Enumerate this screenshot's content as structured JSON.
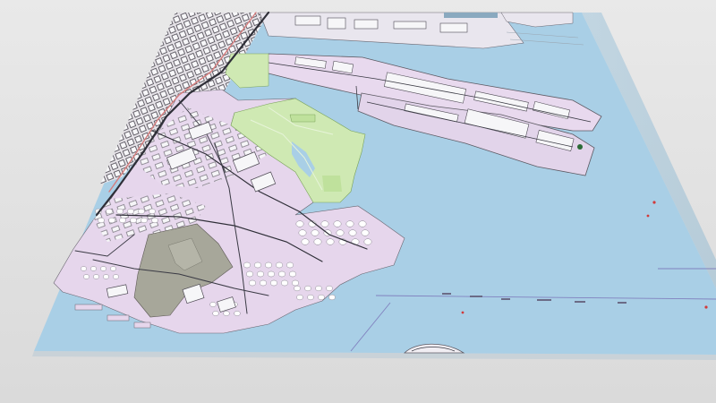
{
  "scene": {
    "view": "3d-tilted-map-tile",
    "colors": {
      "background": "#dcdcdc",
      "water": "#a9cfe6",
      "water_shadow": "#8fb6cf",
      "tile_edge": "#bfc7cd",
      "industrial": "#e6d6ec",
      "park": "#cfe9b3",
      "urban": "#e7e3e8",
      "building": "#f2f2f4",
      "building_outline": "#5d5a63",
      "road": "#3a3a44",
      "road_major": "#d67d7d",
      "gray_land": "#a7a79a",
      "tank": "#ffffff",
      "marker_red": "#d23a3a"
    },
    "features": {
      "piers": "pier",
      "golf_course": "park",
      "oil_terminal": "industrial",
      "landfill": "landfill",
      "city_grid": "urban",
      "channel_markers": "marker"
    }
  }
}
